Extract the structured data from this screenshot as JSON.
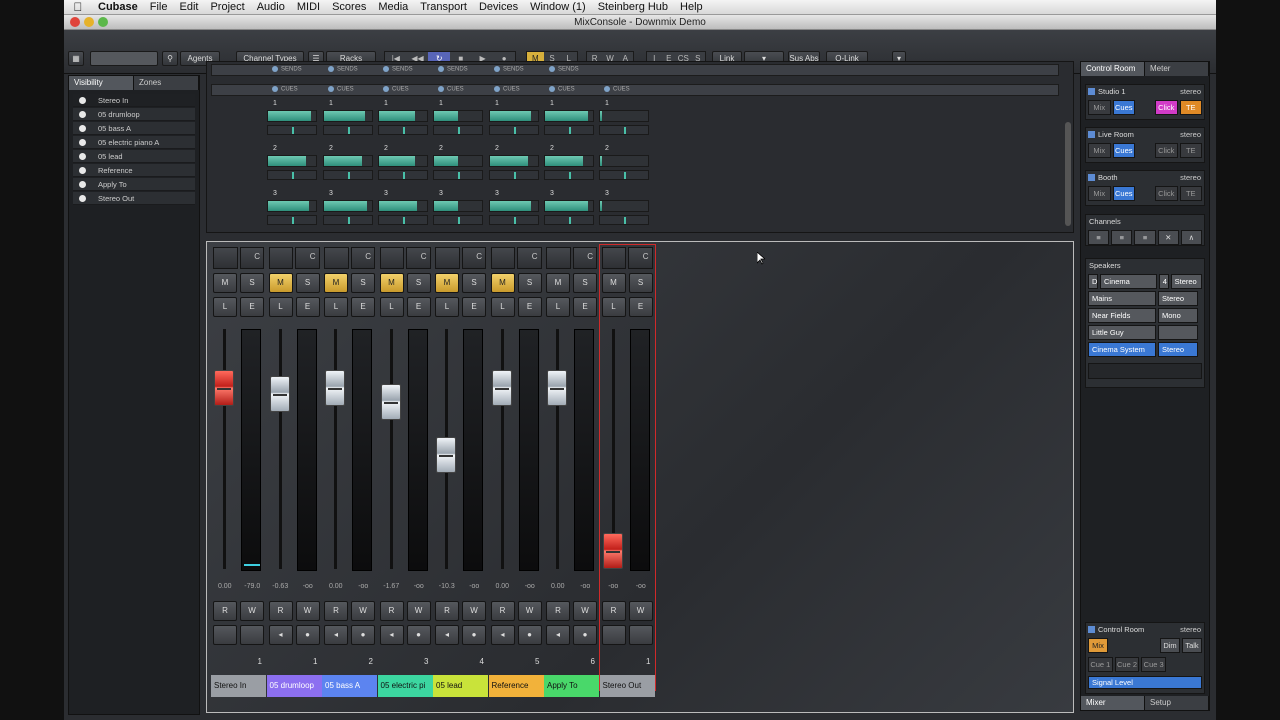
{
  "menubar": {
    "apple": "",
    "items": [
      "Cubase",
      "File",
      "Edit",
      "Project",
      "Audio",
      "MIDI",
      "Scores",
      "Media",
      "Transport",
      "Devices",
      "Window (1)",
      "Steinberg Hub",
      "Help"
    ]
  },
  "window": {
    "title": "MixConsole - Downmix Demo"
  },
  "toolbar": {
    "agents": "Agents",
    "channel_types": "Channel Types",
    "racks": "Racks",
    "msl": [
      "M",
      "S",
      "L"
    ],
    "rwa": [
      "R",
      "W",
      "A"
    ],
    "iecs": [
      "I",
      "E",
      "CS",
      "S"
    ],
    "link": "Link",
    "sus_abs": "Sus Abs",
    "qlink": "Q-Link"
  },
  "left_panel": {
    "tabs": [
      "Visibility",
      "Zones"
    ],
    "items": [
      "Stereo In",
      "05 drumloop",
      "05 bass A",
      "05 electric piano A",
      "05 lead",
      "Reference",
      "Apply To",
      "Stereo Out"
    ]
  },
  "racks": {
    "sends_label": "SENDS",
    "cues_label": "CUES",
    "cue_rows": [
      {
        "num": "1",
        "levels": [
          0.9,
          0.85,
          0.75,
          0.5,
          0.85,
          0.9,
          0.05
        ]
      },
      {
        "num": "2",
        "levels": [
          0.8,
          0.8,
          0.75,
          0.5,
          0.8,
          0.8,
          0.05
        ]
      },
      {
        "num": "3",
        "levels": [
          0.85,
          0.9,
          0.8,
          0.5,
          0.85,
          0.9,
          0.05
        ]
      }
    ]
  },
  "mixer": {
    "channels": [
      {
        "name": "Stereo In",
        "number": "1",
        "color": "#9a9ea4",
        "mute": false,
        "fader_red": true,
        "fader_level": 0.8,
        "vol": "0.00",
        "peak": "-79.0",
        "selected": false
      },
      {
        "name": "05 drumloop",
        "number": "1",
        "color": "#8c6ff0",
        "mute": true,
        "fader_red": false,
        "fader_level": 0.77,
        "vol": "-0.63",
        "peak": "-oo",
        "selected": false
      },
      {
        "name": "05 bass A",
        "number": "2",
        "color": "#5c84f0",
        "mute": true,
        "fader_red": false,
        "fader_level": 0.8,
        "vol": "0.00",
        "peak": "-oo",
        "selected": false
      },
      {
        "name": "05 electric pi",
        "number": "3",
        "color": "#3cd6a0",
        "mute": true,
        "fader_red": false,
        "fader_level": 0.73,
        "vol": "-1.67",
        "peak": "-oo",
        "selected": false
      },
      {
        "name": "05 lead",
        "number": "4",
        "color": "#c9e33a",
        "mute": true,
        "fader_red": false,
        "fader_level": 0.47,
        "vol": "-10.3",
        "peak": "-oo",
        "selected": false
      },
      {
        "name": "Reference",
        "number": "5",
        "color": "#f2b23a",
        "mute": true,
        "fader_red": false,
        "fader_level": 0.8,
        "vol": "0.00",
        "peak": "-oo",
        "selected": false
      },
      {
        "name": "Apply To",
        "number": "6",
        "color": "#49d86a",
        "mute": false,
        "fader_red": false,
        "fader_level": 0.8,
        "vol": "0.00",
        "peak": "-oo",
        "selected": false
      },
      {
        "name": "Stereo Out",
        "number": "1",
        "color": "#9a9ea4",
        "mute": false,
        "fader_red": true,
        "fader_level": 0.0,
        "vol": "-oo",
        "peak": "-oo",
        "selected": true
      }
    ],
    "top_letter": "C",
    "labels": {
      "m": "M",
      "s": "S",
      "l": "L",
      "e": "E",
      "r": "R",
      "w": "W"
    }
  },
  "right_panel": {
    "tabs": [
      "Control Room",
      "Meter"
    ],
    "studios": [
      {
        "name": "Studio 1",
        "format": "stereo",
        "buttons": [
          "Mix",
          "Cues",
          "Click",
          "TE"
        ],
        "styles": [
          "dark",
          "blue",
          "pink",
          "orange"
        ]
      },
      {
        "name": "Live Room",
        "format": "stereo",
        "buttons": [
          "Mix",
          "Cues",
          "Click",
          "TE"
        ],
        "styles": [
          "dark",
          "blue",
          "dark",
          "dark"
        ]
      },
      {
        "name": "Booth",
        "format": "stereo",
        "buttons": [
          "Mix",
          "Cues",
          "Click",
          "TE"
        ],
        "styles": [
          "dark",
          "blue",
          "dark",
          "dark"
        ]
      }
    ],
    "channels_label": "Channels",
    "speakers_label": "Speakers",
    "speaker_top": [
      "D",
      "Cinema System",
      "4",
      "Stereo"
    ],
    "speakers": [
      {
        "name": "Mains",
        "format": "Stereo",
        "selected": false
      },
      {
        "name": "Near Fields",
        "format": "Mono",
        "selected": false
      },
      {
        "name": "Little Guy",
        "format": "",
        "selected": false
      },
      {
        "name": "Cinema System",
        "format": "Stereo",
        "selected": true
      }
    ],
    "control_room": {
      "name": "Control Room",
      "format": "stereo",
      "mix": "Mix",
      "dim": "Dim",
      "talk": "Talk",
      "cues": [
        "Cue 1",
        "Cue 2",
        "Cue 3"
      ],
      "signal": "Signal Level"
    },
    "bottom_tabs": [
      "Mixer",
      "Setup"
    ]
  },
  "colors": {
    "accent_mute": "#e0b040",
    "cue_fill": "#4fb8a0",
    "selected_outline": "#d02a2a"
  }
}
